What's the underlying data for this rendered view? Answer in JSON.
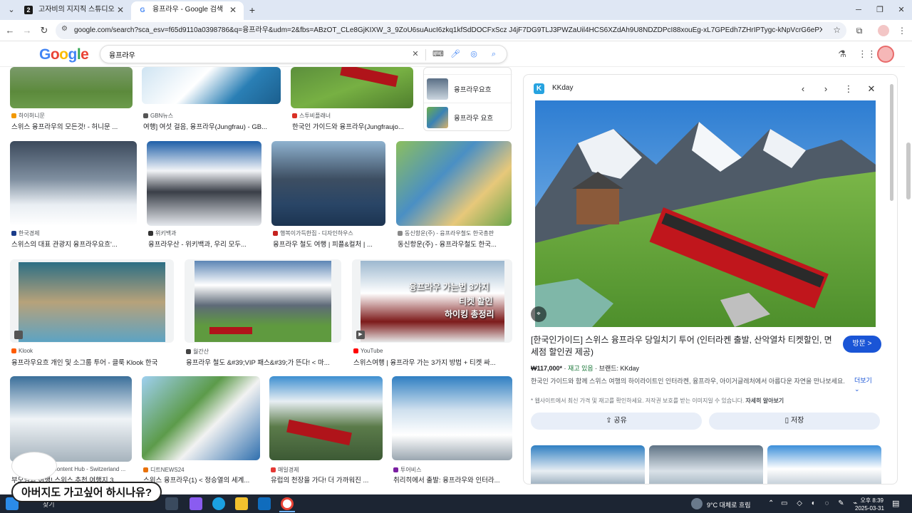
{
  "tabs": [
    {
      "label": "고자비의 지지직 스튜디오",
      "icon": "2"
    },
    {
      "label": "융프라우 - Google 검색",
      "icon": "G"
    }
  ],
  "url": "google.com/search?sca_esv=f65d9110a0398786&q=융프라우&udm=2&fbs=ABzOT_CLe8GjKIXW_3_9ZoU6suAucI6zkq1kfSdDOCFxScz J4jF7DG9TLJ3PWZaUil4HCS6XZdAh9U8NDZDPcI88xouEg-xL7GPEdh7ZHrIPTygc-kNpVcrG6ePXYMEEwHcLIMS2VFH...",
  "search": {
    "query": "융프라우",
    "logo": "Google"
  },
  "colors": {
    "accent": "#1a55d6",
    "brand_blue": "#4285f4"
  },
  "results": [
    {
      "source": "하이허니문",
      "title": "스위스 융프라우의 모든것! - 허니문 ..."
    },
    {
      "source": "GBN뉴스",
      "title": "여행] 여섯 걸음, 융프라우(Jungfrau) - GB..."
    },
    {
      "source": "스투비플래너",
      "title": "한국인 가이드와 융프라우(Jungfraujo..."
    },
    {
      "source": "한국경제",
      "title": "스위스의 대표 관광지 융프라우요흐'..."
    },
    {
      "source": "위키백과",
      "title": "융프라우산 - 위키백과, 우리 모두..."
    },
    {
      "source": "행복이가득한집 - 디자인하우스",
      "title": "융프라우 철도 여행 | 피플&컬처 | ..."
    },
    {
      "source": "동신항운(주) - 융프라우철도 한국총판",
      "title": "동신항운(주) - 융프라우철도 한국..."
    },
    {
      "source": "Klook",
      "title": "융프라우요흐 개인 및 소그룹 투어 - 클룩 Klook 한국"
    },
    {
      "source": "월간산",
      "title": "융프라우 철도 &#39;VIP 패스&#39;가 뜬다! < 마..."
    },
    {
      "source": "YouTube",
      "title": "스위스여행 | 융프라우 가는 3가지 방법 + 티켓 싸..."
    },
    {
      "source": "Content Hub - Switzerland ...",
      "title": "부모님과 여행! 스위스 추천 여행지 3..."
    },
    {
      "source": "디트NEWS24",
      "title": "스위스 융프라우(1) < 정승열의 세계..."
    },
    {
      "source": "매일경제",
      "title": "유럽의 천장을 가다! 더 가까워진 ..."
    },
    {
      "source": "투어비스",
      "title": "취리히에서 출발: 융프라우와 인터라..."
    }
  ],
  "thumb_overlay": {
    "line1": "융프라우 가는법 3가지",
    "line2": "티켓 할인",
    "line3": "하이킹 총정리"
  },
  "related": [
    {
      "label": "융프라우요흐"
    },
    {
      "label": "융프라우 요흐"
    }
  ],
  "panel": {
    "site": "KKday",
    "title": "[한국인가이드] 스위스 융프라우 당일치기 투어 (인터라켄 출발, 산악열차 티켓할인, 면세점 할인권 제공)",
    "visit": "방문 >",
    "price": "₩117,000*",
    "stock": "재고 있음",
    "brand": "브랜드: KKday",
    "description": "한국인 가이드와 함께 스위스 여행의 하이라이트인 인터라켄, 융프라우, 아이거글레처에서 아름다운 자연을 만나보세요.",
    "more": "더보기",
    "note": "* 웹사이트에서 최신 가격 및 재고를 확인하세요. 저작권 보호를 받는 이미지일 수 있습니다.",
    "note_link": "자세히 알아보기",
    "share": "공유",
    "save": "저장"
  },
  "caption": "아버지도 가고싶어 하시나유?",
  "taskbar": {
    "search_placeholder": "찾기",
    "weather": "9°C  대체로 흐림",
    "time": "오후 8:39",
    "date": "2025-03-31"
  }
}
